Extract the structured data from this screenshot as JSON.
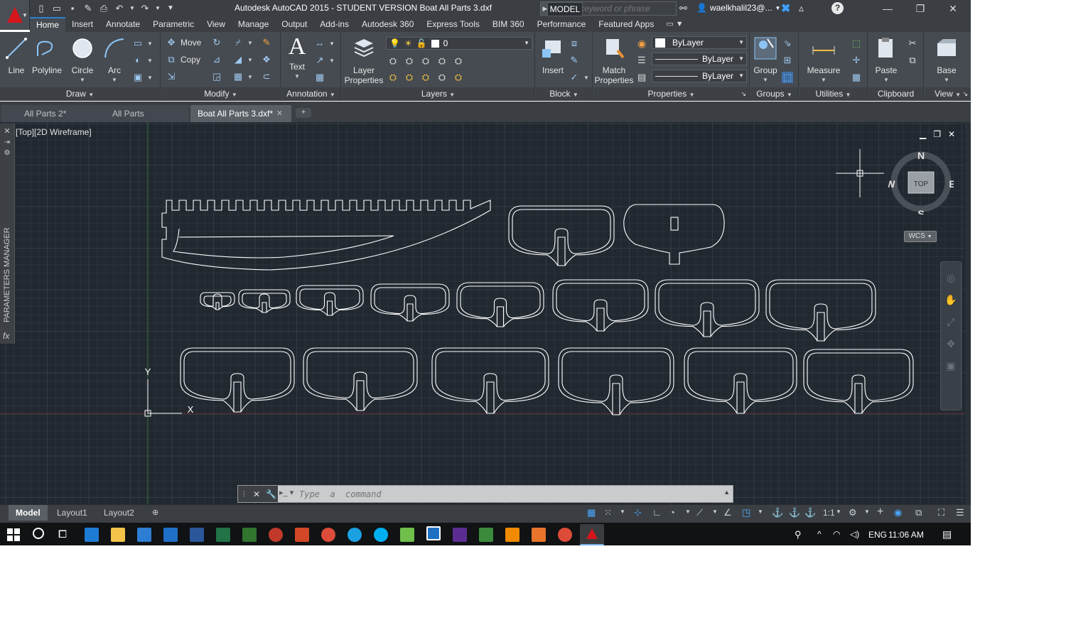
{
  "window": {
    "title": "Autodesk AutoCAD 2015 - STUDENT VERSION    Boat All Parts 3.dxf",
    "search_placeholder": "Type a keyword or phrase",
    "user": "waelkhalil23@...",
    "minimize": "—",
    "restore": "❐",
    "close": "✕"
  },
  "ribbon_tabs": [
    "Home",
    "Insert",
    "Annotate",
    "Parametric",
    "View",
    "Manage",
    "Output",
    "Add-ins",
    "Autodesk 360",
    "Express Tools",
    "BIM 360",
    "Performance",
    "Featured Apps"
  ],
  "ribbon": {
    "draw": {
      "title": "Draw",
      "line": "Line",
      "polyline": "Polyline",
      "circle": "Circle",
      "arc": "Arc"
    },
    "modify": {
      "title": "Modify",
      "move": "Move",
      "copy": "Copy"
    },
    "annotation": {
      "title": "Annotation",
      "text": "Text"
    },
    "layers": {
      "title": "Layers",
      "layer_properties_1": "Layer",
      "layer_properties_2": "Properties",
      "current_layer": "0"
    },
    "block": {
      "title": "Block",
      "insert": "Insert"
    },
    "properties": {
      "title": "Properties",
      "match_1": "Match",
      "match_2": "Properties",
      "color": "ByLayer",
      "linetype": "ByLayer",
      "lineweight": "ByLayer"
    },
    "groups": {
      "title": "Groups",
      "group": "Group"
    },
    "utilities": {
      "title": "Utilities",
      "measure": "Measure"
    },
    "clipboard": {
      "title": "Clipboard",
      "paste": "Paste"
    },
    "view": {
      "title": "View",
      "base": "Base"
    }
  },
  "doc_tabs": [
    {
      "label": "All Parts 2*"
    },
    {
      "label": "All Parts"
    },
    {
      "label": "Boat All Parts 3.dxf*"
    }
  ],
  "viewport": {
    "label": "[Top][2D Wireframe]",
    "palette_label": "PARAMETERS MANAGER",
    "compass": {
      "n": "N",
      "s": "S",
      "e": "E",
      "w": "W",
      "top": "TOP"
    },
    "wcs": "WCS",
    "ucs_x": "X",
    "ucs_y": "Y"
  },
  "command": {
    "placeholder": "Type  a  command"
  },
  "layout_tabs": [
    "Model",
    "Layout1",
    "Layout2"
  ],
  "status": {
    "model": "MODEL",
    "scale": "1:1"
  },
  "taskbar": {
    "lang": "ENG",
    "time": "11:06 AM"
  },
  "colors": {
    "accent": "#2f80d1",
    "canvas": "#212830",
    "logo": "#d4161d"
  }
}
